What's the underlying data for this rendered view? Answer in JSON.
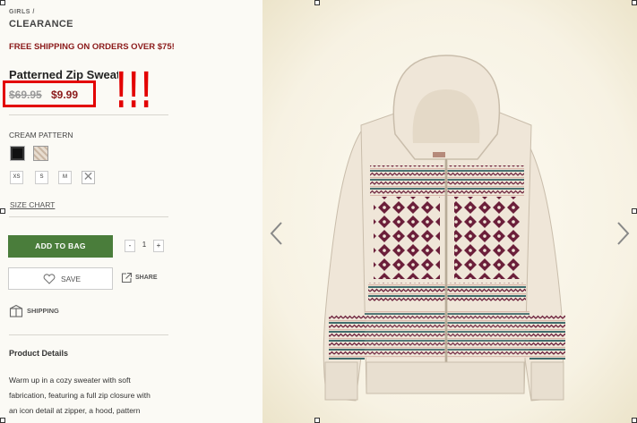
{
  "breadcrumb": {
    "parent": "GIRLS",
    "separator": "/",
    "current": "CLEARANCE"
  },
  "promo": "FREE SHIPPING ON ORDERS OVER $75!",
  "product": {
    "title": "Patterned Zip Sweater",
    "price_old": "$69.95",
    "price_new": "$9.99",
    "annotation": "!!!",
    "color_label": "CREAM PATTERN",
    "sizes": [
      "XS",
      "S",
      "M",
      "✕"
    ],
    "size_chart": "SIZE CHART"
  },
  "actions": {
    "add_to_bag": "ADD TO BAG",
    "qty_minus": "-",
    "qty_value": "1",
    "qty_plus": "+",
    "save": "SAVE",
    "share": "SHARE",
    "shipping": "SHIPPING"
  },
  "details": {
    "title": "Product Details",
    "lines": [
      "Warm up in a cozy sweater with soft",
      "fabrication, featuring a full zip closure with",
      "an icon detail at zipper, a hood, pattern"
    ]
  },
  "colors": {
    "annotation_red": "#e30000",
    "add_button": "#4a7d3b",
    "price_red": "#8b1a1a",
    "sweater": "#efe6d8",
    "fairisle_maroon": "#6b1f3a"
  }
}
